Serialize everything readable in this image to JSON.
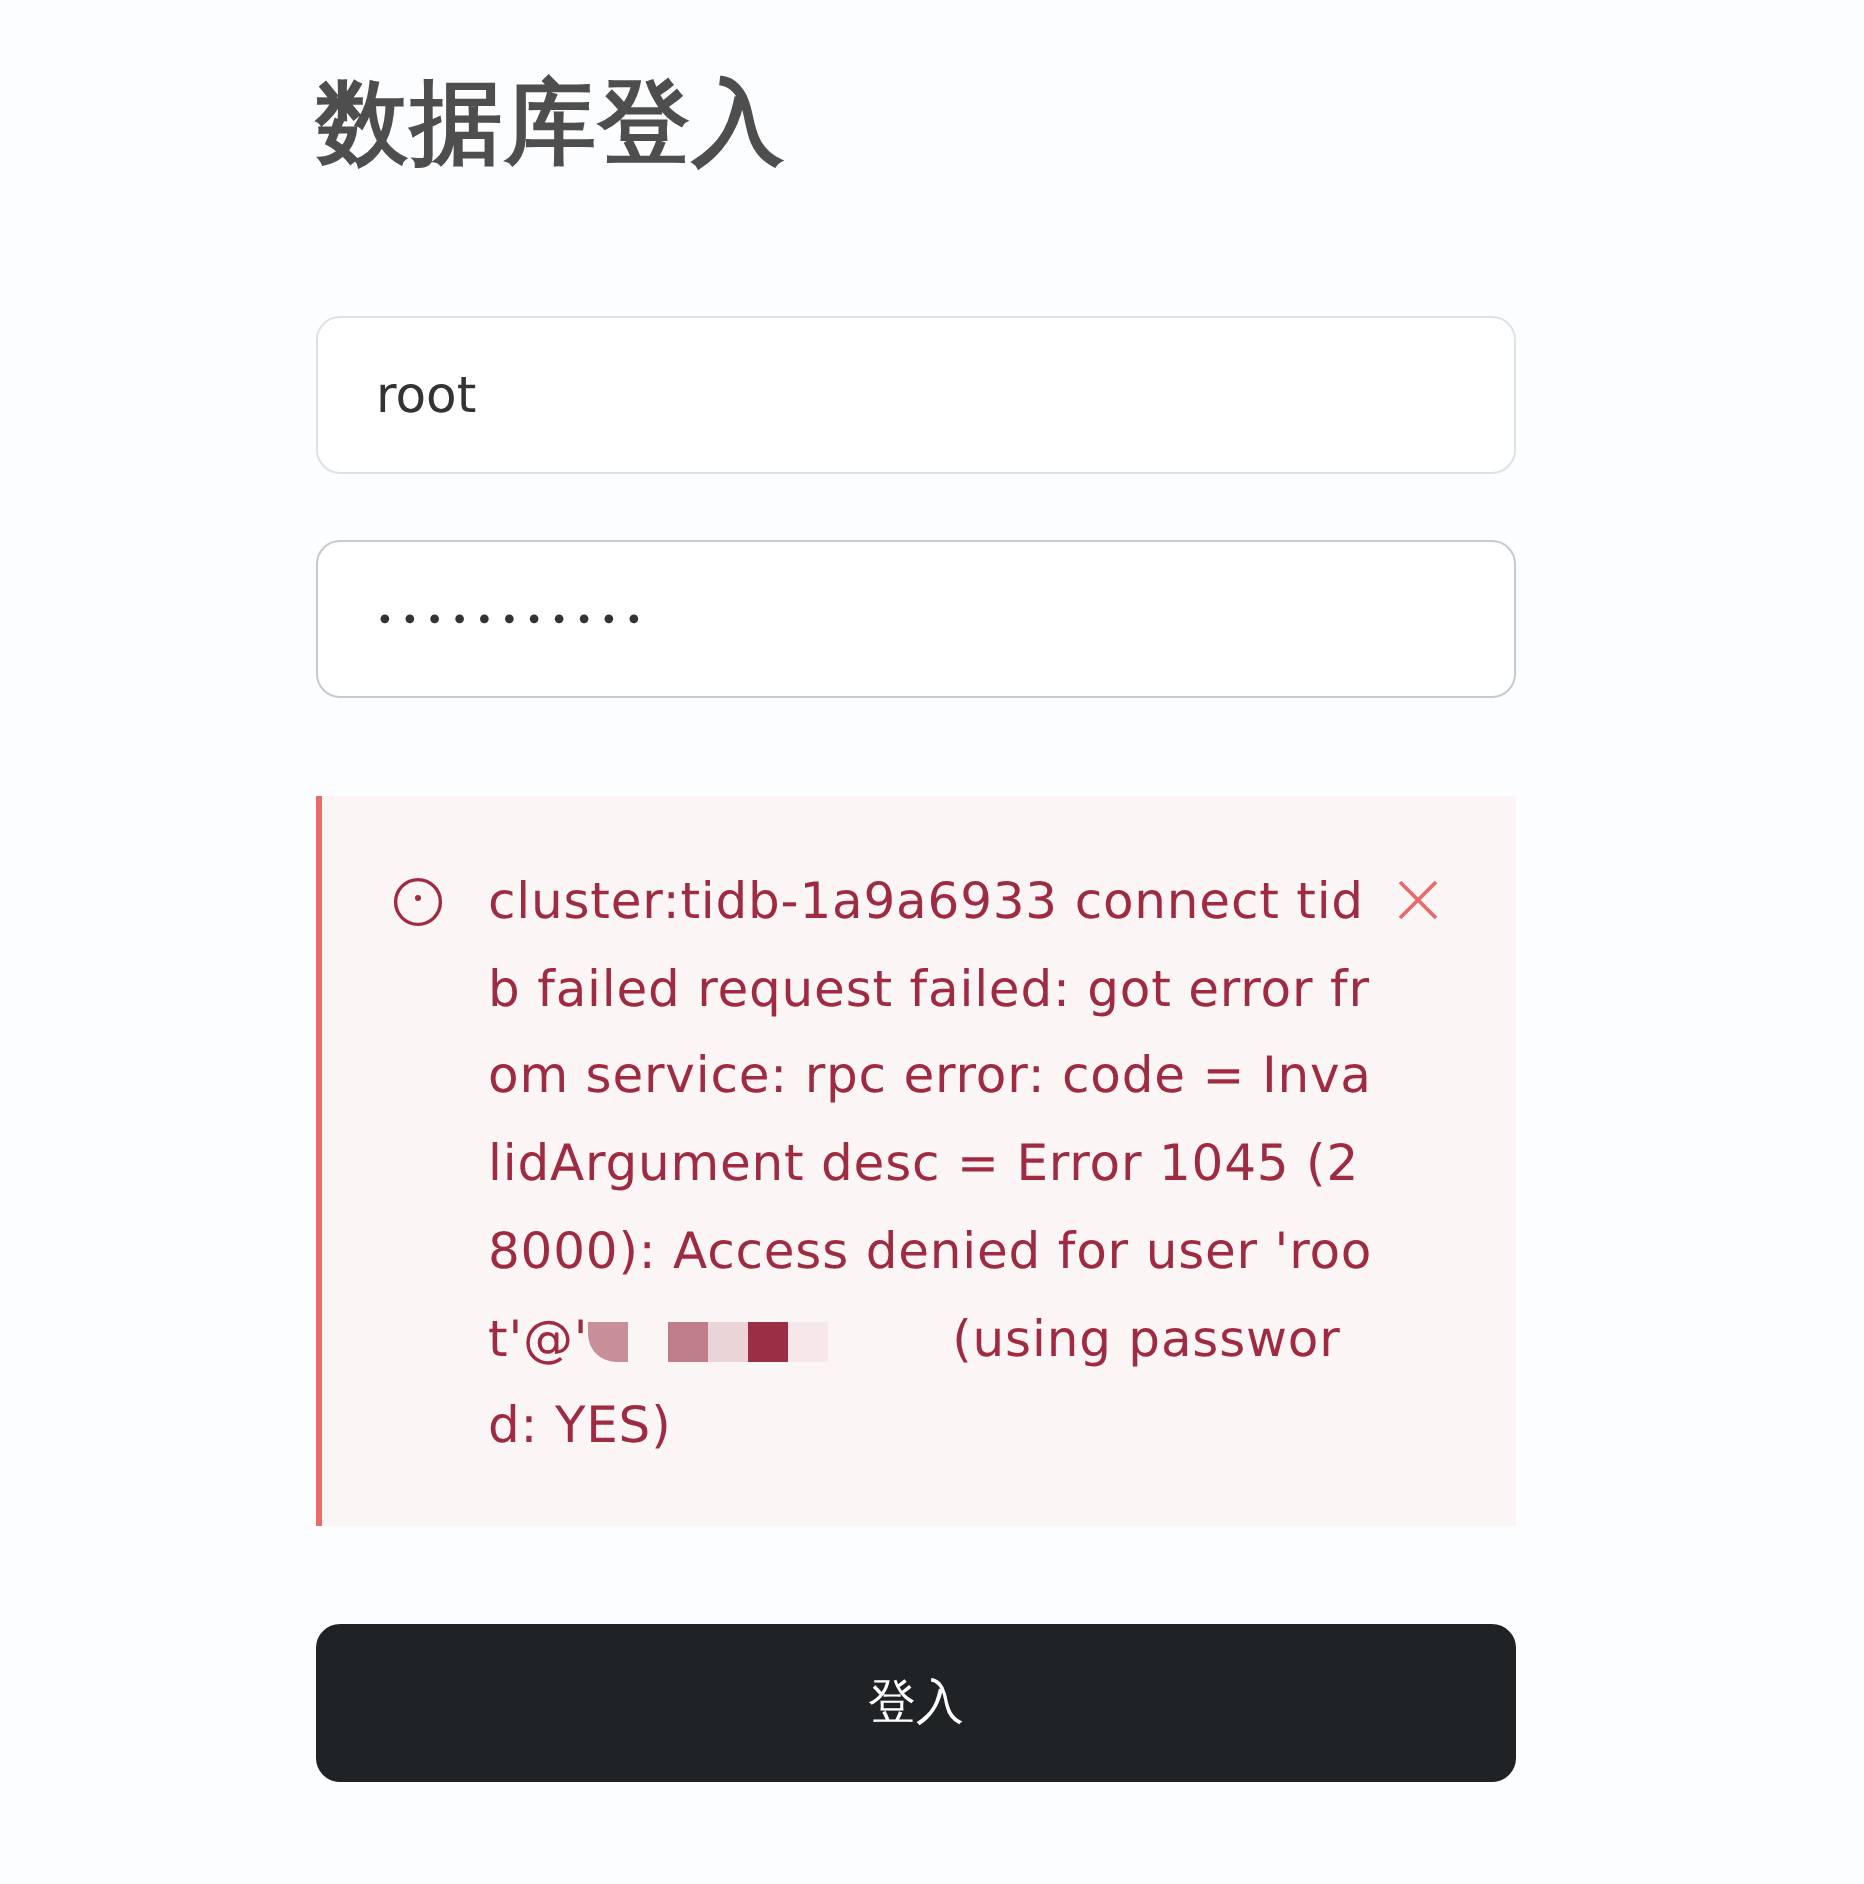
{
  "title": "数据库登入",
  "fields": [
    {
      "kind": "text",
      "value": "root",
      "focused": false
    },
    {
      "kind": "password",
      "value": "•••••••••••",
      "focused": true
    }
  ],
  "alert": {
    "kind": "error",
    "dismissible": true,
    "message": [
      {
        "kind": "text",
        "text": "cluster:tidb-1a9a6933 connect tidb failed request failed: got error from service: rpc error: code = InvalidArgument desc = Error 1045 (28000): Access denied for user 'root'@'"
      },
      {
        "kind": "redacted"
      },
      {
        "kind": "text",
        "text": "(using password: YES)"
      }
    ]
  },
  "submit_button": {
    "label": "登入"
  }
}
